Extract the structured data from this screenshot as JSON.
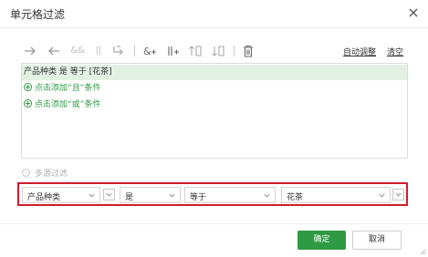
{
  "dialog": {
    "title": "单元格过滤"
  },
  "toolbar": {
    "icons": [
      "arrow-right-icon",
      "arrow-left-icon",
      "and-icon",
      "or-icon",
      "switch-icon",
      "add-and-icon",
      "add-or-icon",
      "move-up-icon",
      "move-down-icon",
      "delete-icon"
    ],
    "and_glyph": "&&",
    "or_glyph": "||",
    "auto_adjust": "自动调整",
    "clear": "清空"
  },
  "conditions": {
    "rows": [
      {
        "text": "产品种类 是 等于 [花茶]",
        "selected": true
      }
    ],
    "add_and": "点击添加“且”条件",
    "add_or": "点击添加“或”条件"
  },
  "multi_source": {
    "label": "多源过滤",
    "checked": false
  },
  "filter": {
    "field": "产品种类",
    "is": "是",
    "operator": "等于",
    "value": "花茶"
  },
  "footer": {
    "ok": "确定",
    "cancel": "取消"
  },
  "colors": {
    "accent": "#2e9a42",
    "highlight_border": "#d21b2c",
    "selected_row_bg": "#e3f1e3"
  }
}
